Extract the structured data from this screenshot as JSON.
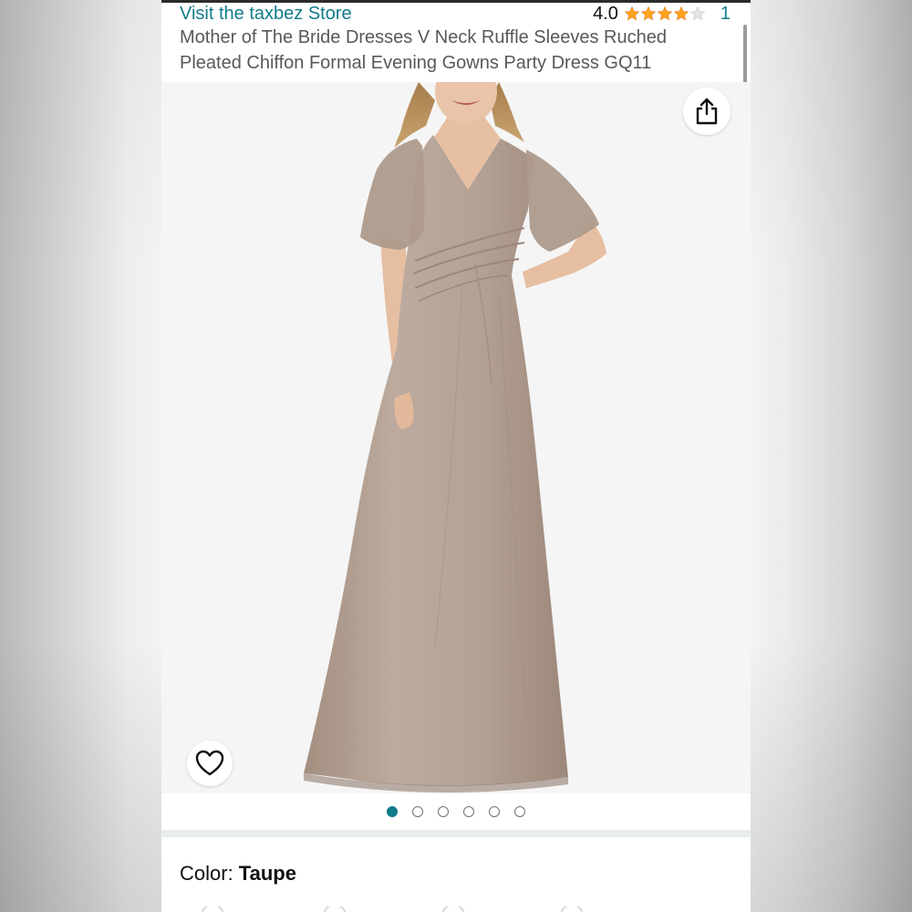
{
  "store": {
    "link_text": "Visit the taxbez Store"
  },
  "rating": {
    "value": "4.0",
    "stars": 4,
    "count": "1"
  },
  "product": {
    "title": "Mother of The Bride Dresses V Neck Ruffle Sleeves Ruched Pleated Chiffon Formal Evening Gowns Party Dress GQ11",
    "image_alt": "Woman wearing a floor-length taupe chiffon gown with flutter sleeves"
  },
  "carousel": {
    "count": 6,
    "active_index": 0
  },
  "color": {
    "label": "Color: ",
    "value": "Taupe"
  },
  "icons": {
    "share": "share-icon",
    "favorite": "heart-icon",
    "star": "star-icon"
  },
  "colors": {
    "link": "#117c8a",
    "star": "#ffa41c",
    "dress": "#b3a193",
    "text": "#0f1111"
  }
}
